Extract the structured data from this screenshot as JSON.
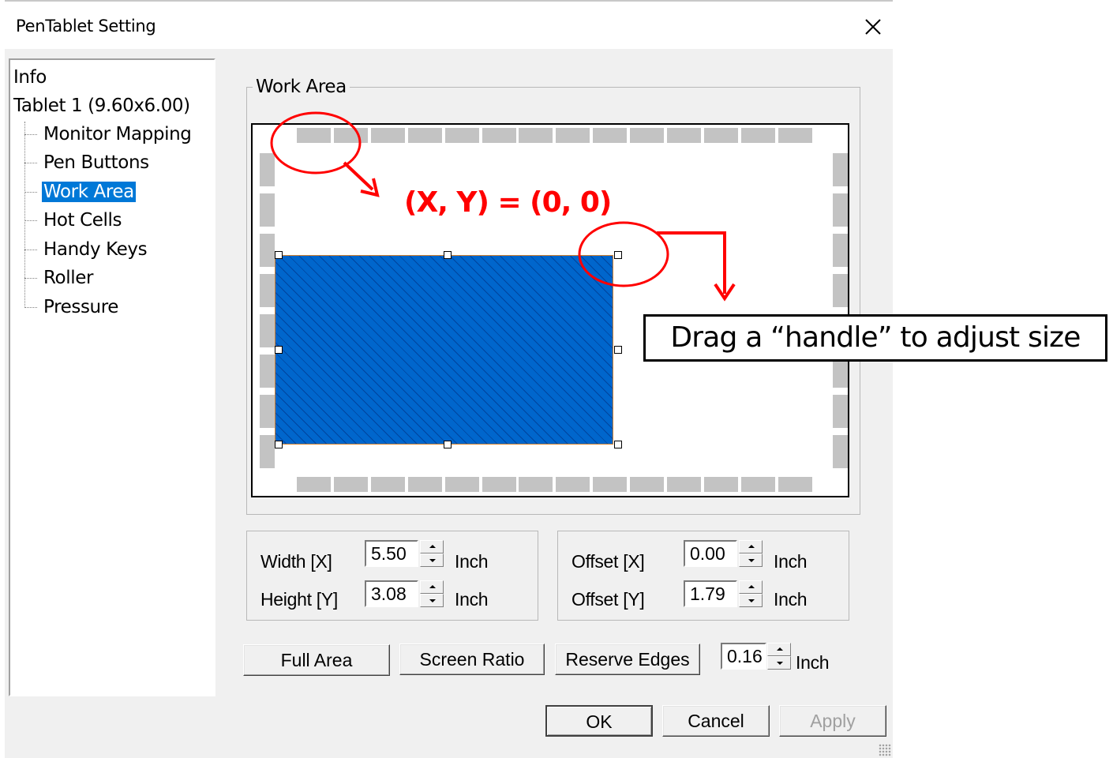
{
  "window": {
    "title": "PenTablet Setting",
    "close_icon": "close-icon"
  },
  "tree": {
    "root_items": [
      "Info",
      "Tablet  1 (9.60x6.00)"
    ],
    "children": [
      "Monitor Mapping",
      "Pen Buttons",
      "Work Area",
      "Hot Cells",
      "Handy Keys",
      "Roller",
      "Pressure"
    ],
    "selected": "Work Area"
  },
  "work_area": {
    "legend": "Work Area",
    "rect_color": "#0066cc",
    "cell_color": "#c3c3c3"
  },
  "size": {
    "width_label": "Width [X]",
    "width_value": "5.50",
    "height_label": "Height [Y]",
    "height_value": "3.08",
    "unit": "Inch"
  },
  "offset": {
    "x_label": "Offset [X]",
    "x_value": "0.00",
    "y_label": "Offset [Y]",
    "y_value": "1.79",
    "unit": "Inch"
  },
  "actions": {
    "full_area": "Full Area",
    "screen_ratio": "Screen Ratio",
    "reserve_edges": "Reserve Edges",
    "reserve_value": "0.16",
    "reserve_unit": "Inch"
  },
  "footer": {
    "ok": "OK",
    "cancel": "Cancel",
    "apply": "Apply"
  },
  "annotations": {
    "coords": "(X, Y) = (0, 0)",
    "handle_note": "Drag a “handle” to adjust size",
    "color": "#ff0000"
  }
}
